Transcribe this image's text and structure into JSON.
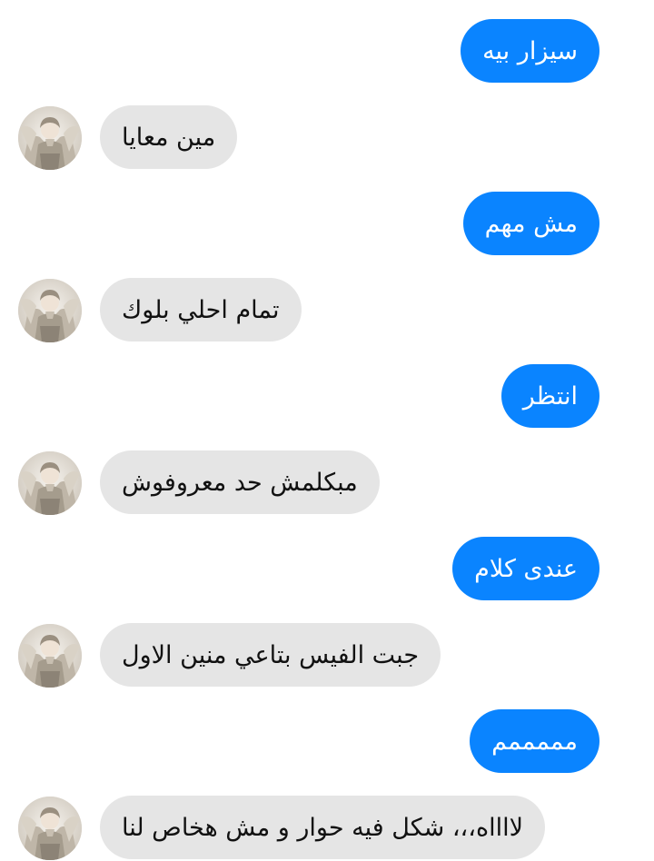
{
  "conversation": {
    "colors": {
      "outgoing_bubble": "#0a84ff",
      "outgoing_text": "#ffffff",
      "incoming_bubble": "#e5e5e5",
      "incoming_text": "#111111"
    },
    "contact": {
      "avatar": "contact-avatar-photo"
    },
    "messages": [
      {
        "from": "me",
        "text": "سيزار بيه"
      },
      {
        "from": "contact",
        "text": "مين معايا"
      },
      {
        "from": "me",
        "text": "مش مهم"
      },
      {
        "from": "contact",
        "text": "تمام احلي بلوك"
      },
      {
        "from": "me",
        "text": "انتظر"
      },
      {
        "from": "contact",
        "text": "مبكلمش حد معروفوش"
      },
      {
        "from": "me",
        "text": "عندى كلام"
      },
      {
        "from": "contact",
        "text": "جبت الفيس بتاعي منين الاول"
      },
      {
        "from": "me",
        "text": "مممممم"
      },
      {
        "from": "contact",
        "text": "لااااه،،، شكل فيه حوار و مش هخاص لنا"
      }
    ]
  }
}
